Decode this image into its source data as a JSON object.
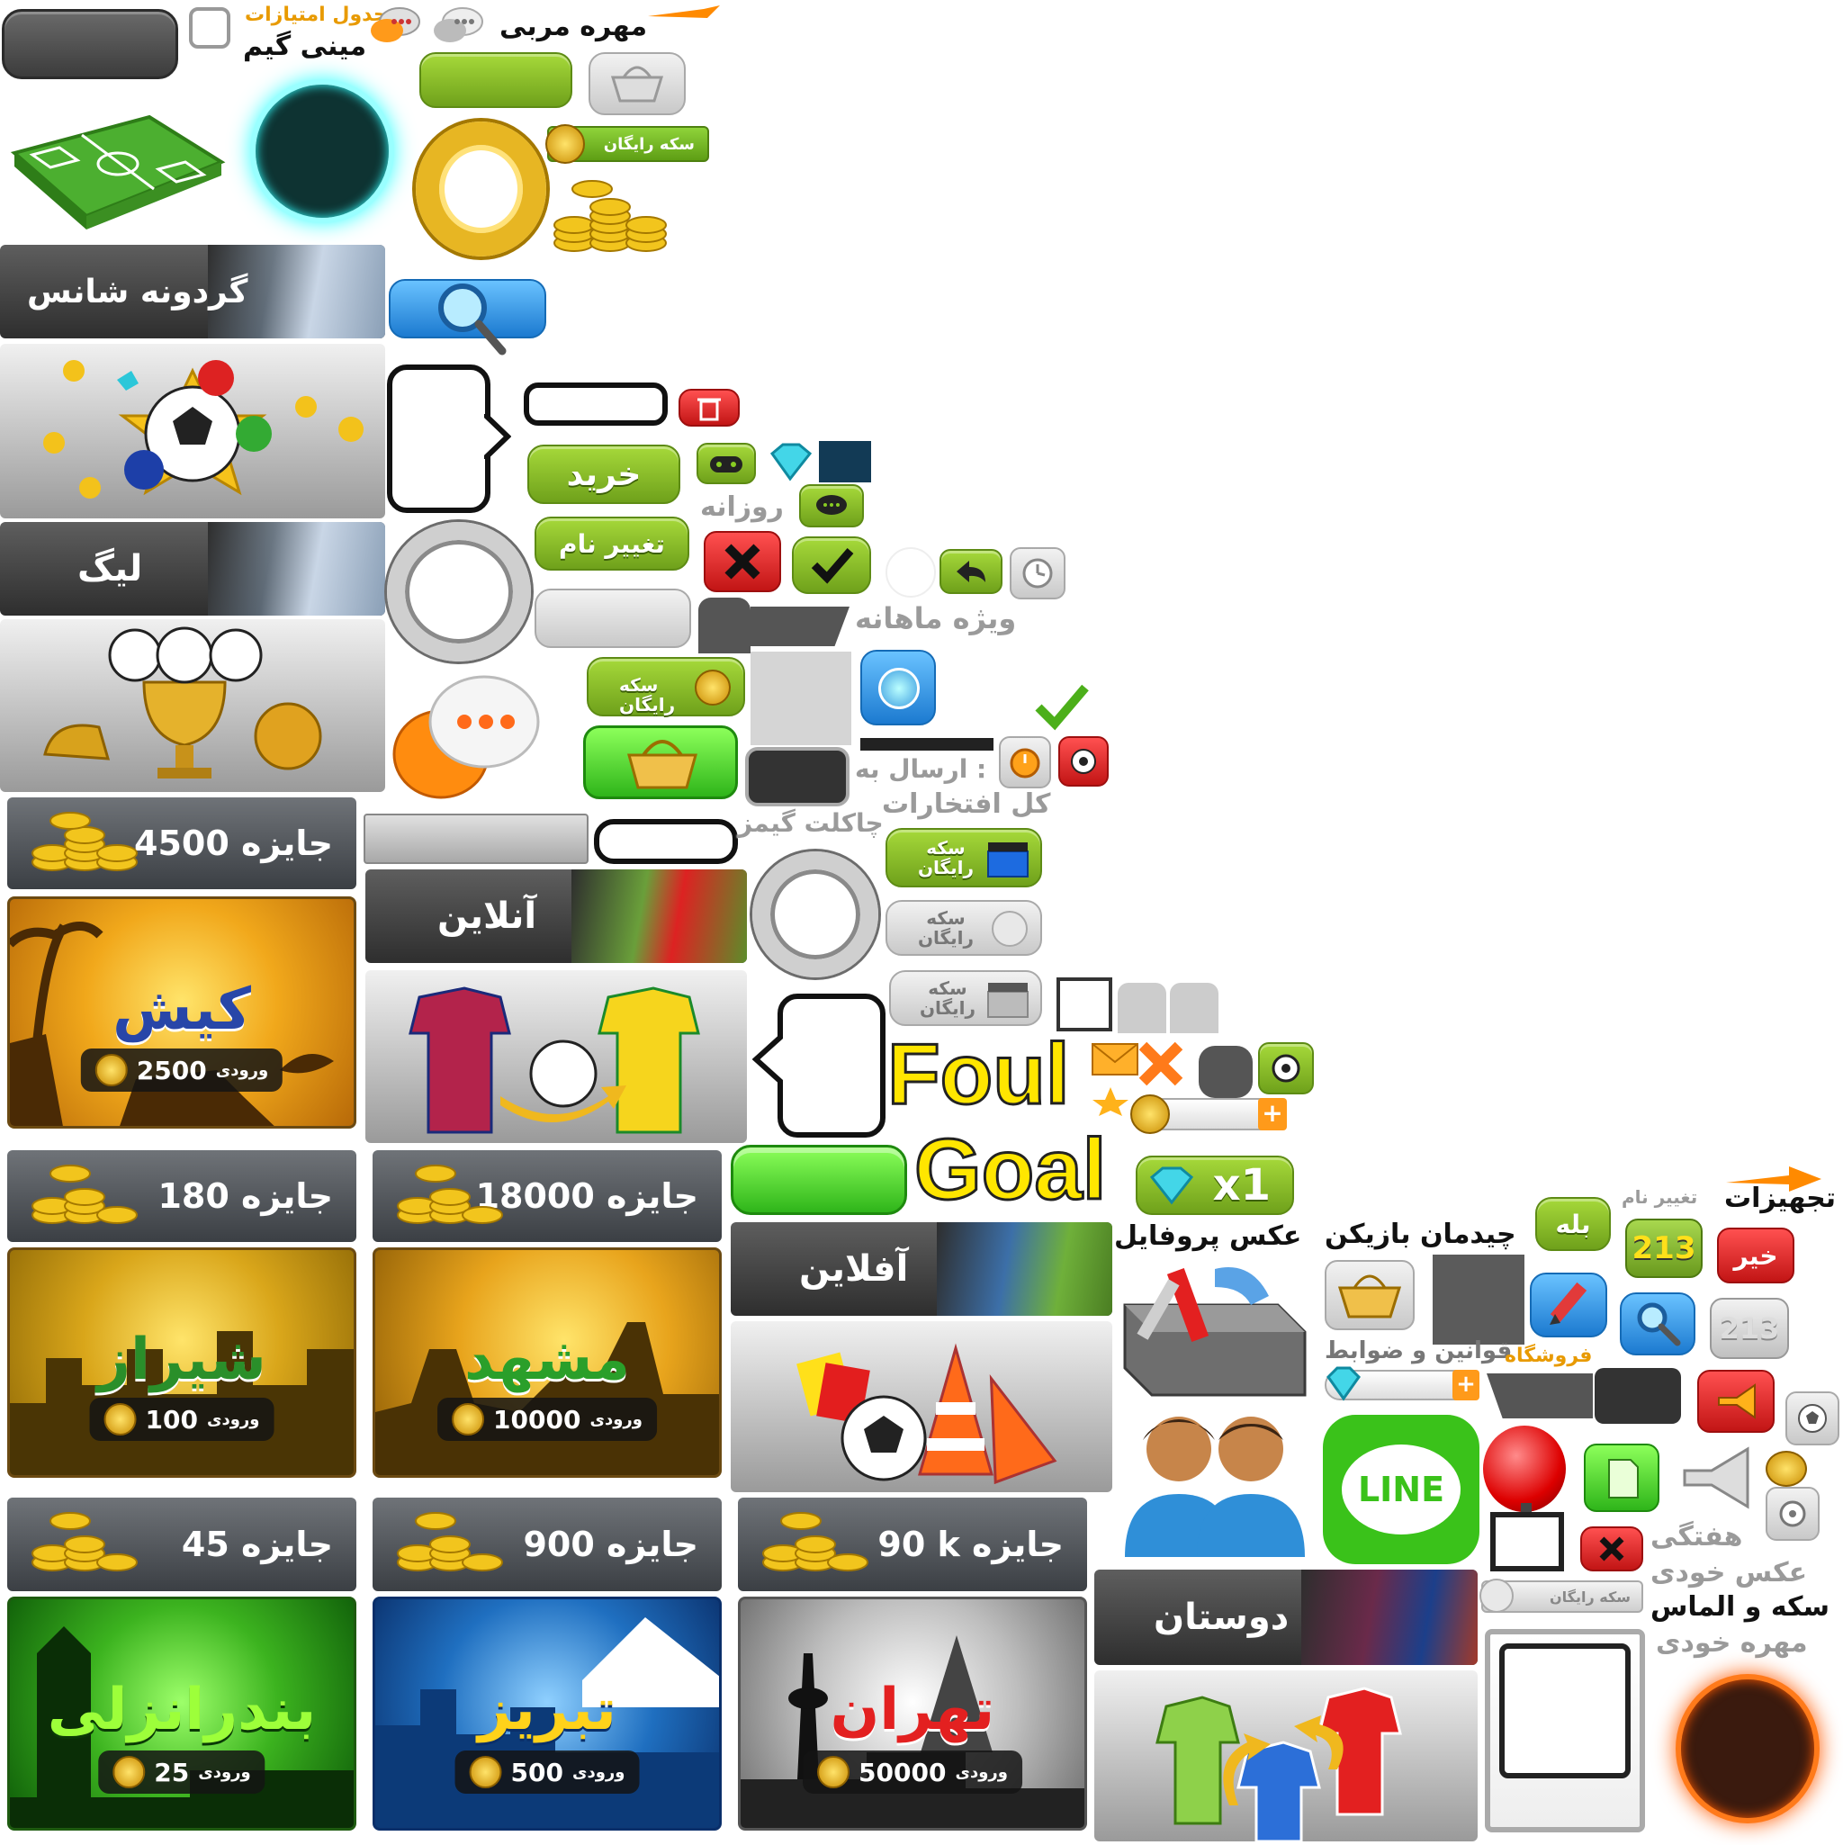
{
  "labels": {
    "chart_points": "جدول امتیازات",
    "mini_game": "مینی گیم",
    "mohre": "مهره مربی",
    "free_coin_small": "سکه رایگان",
    "wheel": "گردونه شانس",
    "league": "لیگ",
    "buy": "خرید",
    "rename": "تغییر نام",
    "daily": "روزانه",
    "monthly": "ویژه ماهانه",
    "free_coin_2line_a": "سکه",
    "free_coin_2line_b": "رایگان",
    "send_to": "ارسال به :",
    "all_honors": "کل افتخارات",
    "chocolate_games": "چاکلت گیمز",
    "online": "آنلاین",
    "offline": "آفلاین",
    "foul": "Foul",
    "goal": "Goal",
    "gem_x1": "x1",
    "profile_photo": "عکس پروفایل",
    "equipment": "تجهیزات",
    "rename_small": "تغییر نام",
    "yes": "بله",
    "no": "خیر",
    "lineup": "چیدمان بازیکن",
    "rules": "قوانین و ضوابط",
    "shop": "فروشگاه",
    "weekly": "هفتگی",
    "my_photo": "عکس خودی",
    "coin_and_diamond": "سکه و الماس",
    "my_piece": "مهره خودی",
    "friends": "دوستان",
    "line_logo": "LINE",
    "score_213": "213"
  },
  "prizes": [
    {
      "label": "جایزه",
      "value": "4500"
    },
    {
      "label": "جایزه",
      "value": "180"
    },
    {
      "label": "جایزه",
      "value": "18000"
    },
    {
      "label": "جایزه",
      "value": "45"
    },
    {
      "label": "جایزه",
      "value": "900"
    },
    {
      "label": "جایزه",
      "value": "90 k"
    }
  ],
  "cities": [
    {
      "name": "کیش",
      "entry_label": "ورودی",
      "entry": "2500",
      "color": "#f1a81b"
    },
    {
      "name": "شیراز",
      "entry_label": "ورودی",
      "entry": "100",
      "color": "#d9a61a"
    },
    {
      "name": "مشهد",
      "entry_label": "ورودی",
      "entry": "10000",
      "color": "#e8a41c"
    },
    {
      "name": "بندرانزلی",
      "entry_label": "ورودی",
      "entry": "25",
      "color": "#3cb31f"
    },
    {
      "name": "تبریز",
      "entry_label": "ورودی",
      "entry": "500",
      "color": "#1f6fc0"
    },
    {
      "name": "تهران",
      "entry_label": "ورودی",
      "entry": "50000",
      "color": "#9a9a9a"
    }
  ],
  "colors": {
    "green_button": "#8cc22a",
    "gold": "#e7b623",
    "dark_banner": "#3a3a3a",
    "red_button": "#d01c1c",
    "blue_button": "#2a8ae0",
    "line_green": "#3ac21a",
    "foul_goal_yellow": "#ffe600"
  }
}
